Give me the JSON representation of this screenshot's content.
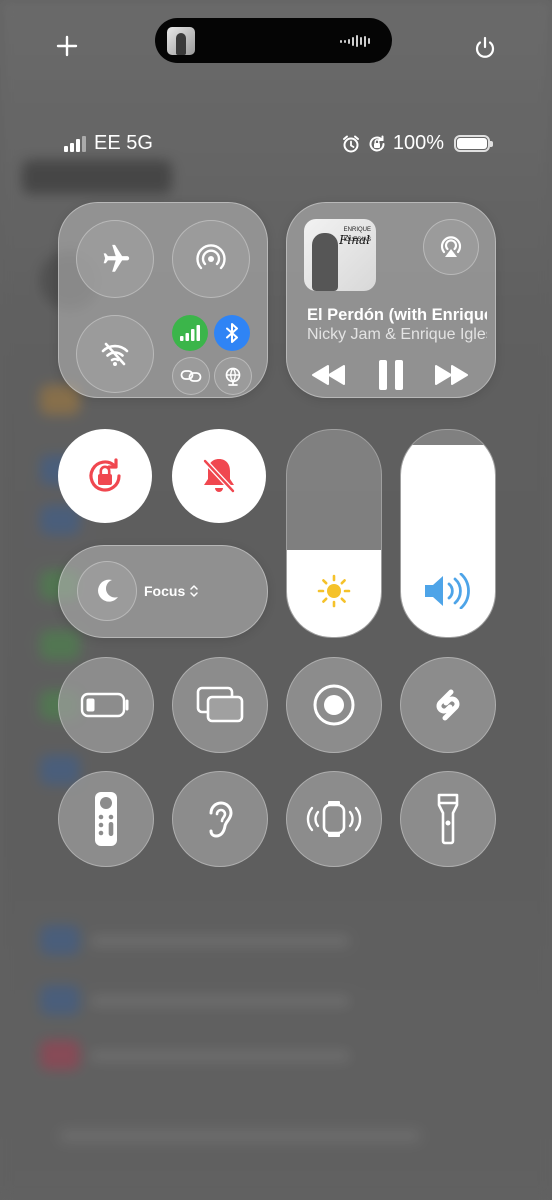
{
  "top": {
    "add_label": "+"
  },
  "status_bar": {
    "carrier": "EE 5G",
    "battery_percent": "100%",
    "signal_level": 3,
    "battery_fill": 1.0
  },
  "connectivity": {
    "airplane_mode": false,
    "hotspot": false,
    "wifi": false,
    "cellular": true,
    "bluetooth": true
  },
  "now_playing": {
    "song": "El Perdón (with Enrique Iglesias)",
    "artist": "Nicky Jam & Enrique Iglesias",
    "cover_text_small": "ENRIQUE IGLESIAS",
    "cover_text_title": "Final",
    "state": "playing"
  },
  "focus": {
    "label": "Focus"
  },
  "brightness": {
    "level": 0.42
  },
  "volume": {
    "level": 0.93
  },
  "colors": {
    "red": "#f0474f",
    "blue_toggle": "#2f84f5",
    "green_toggle": "#3bb54a",
    "sun": "#f5c22a",
    "volume_blue": "#4ea4e8"
  }
}
